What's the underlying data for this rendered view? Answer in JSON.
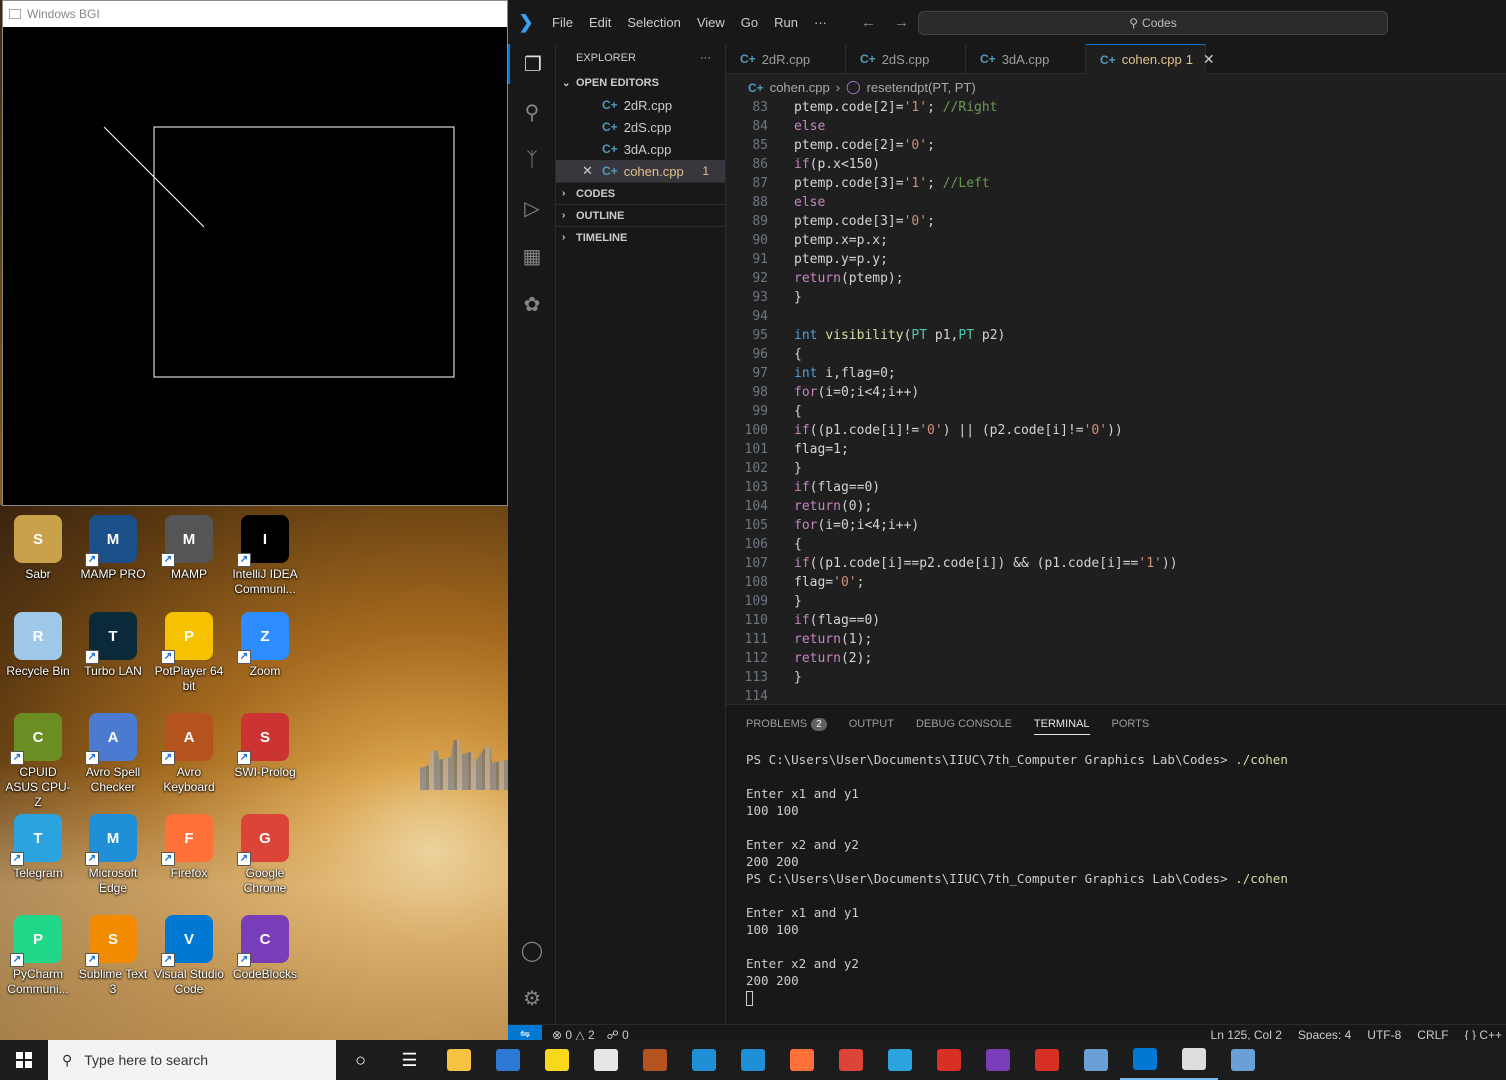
{
  "bgi_window": {
    "title": "Windows BGI"
  },
  "desktop_icons": [
    {
      "label": "Sabr",
      "color": "#c9a14a"
    },
    {
      "label": "MAMP PRO",
      "color": "#1b4f8a"
    },
    {
      "label": "MAMP",
      "color": "#555555"
    },
    {
      "label": "IntelliJ IDEA Communi...",
      "color": "#000000"
    },
    {
      "label": "Recycle Bin",
      "color": "#9ec7e8"
    },
    {
      "label": "Turbo LAN",
      "color": "#0a2a3a"
    },
    {
      "label": "PotPlayer 64 bit",
      "color": "#f6c200"
    },
    {
      "label": "Zoom",
      "color": "#2d8cff"
    },
    {
      "label": "CPUID ASUS CPU-Z",
      "color": "#6b8e23"
    },
    {
      "label": "Avro Spell Checker",
      "color": "#4a7bd0"
    },
    {
      "label": "Avro Keyboard",
      "color": "#b5531f"
    },
    {
      "label": "SWI-Prolog",
      "color": "#cc3333"
    },
    {
      "label": "Telegram",
      "color": "#2aa3df"
    },
    {
      "label": "Microsoft Edge",
      "color": "#1f8fd8"
    },
    {
      "label": "Firefox",
      "color": "#ff7139"
    },
    {
      "label": "Google Chrome",
      "color": "#db4437"
    },
    {
      "label": "PyCharm Communi...",
      "color": "#21d789"
    },
    {
      "label": "Sublime Text 3",
      "color": "#f28b00"
    },
    {
      "label": "Visual Studio Code",
      "color": "#0078d4"
    },
    {
      "label": "CodeBlocks",
      "color": "#7a3db8"
    }
  ],
  "vscode": {
    "menu": [
      "File",
      "Edit",
      "Selection",
      "View",
      "Go",
      "Run",
      "···"
    ],
    "command_center": "Codes",
    "explorer_title": "EXPLORER",
    "open_editors_label": "OPEN EDITORS",
    "open_editors": [
      {
        "name": "2dR.cpp"
      },
      {
        "name": "2dS.cpp"
      },
      {
        "name": "3dA.cpp"
      },
      {
        "name": "cohen.cpp",
        "problems": "1"
      }
    ],
    "sections": [
      "CODES",
      "OUTLINE",
      "TIMELINE"
    ],
    "tabs": [
      {
        "name": "2dR.cpp"
      },
      {
        "name": "2dS.cpp"
      },
      {
        "name": "3dA.cpp"
      },
      {
        "name": "cohen.cpp",
        "problems": "1"
      }
    ],
    "breadcrumb": {
      "file": "cohen.cpp",
      "symbol": "resetendpt(PT, PT)"
    },
    "code_lines": [
      {
        "n": "83",
        "text": "ptemp.code[2]='1'; //Right"
      },
      {
        "n": "84",
        "text": "else"
      },
      {
        "n": "85",
        "text": "ptemp.code[2]='0';"
      },
      {
        "n": "86",
        "text": "if(p.x<150)"
      },
      {
        "n": "87",
        "text": "ptemp.code[3]='1'; //Left"
      },
      {
        "n": "88",
        "text": "else"
      },
      {
        "n": "89",
        "text": "ptemp.code[3]='0';"
      },
      {
        "n": "90",
        "text": "ptemp.x=p.x;"
      },
      {
        "n": "91",
        "text": "ptemp.y=p.y;"
      },
      {
        "n": "92",
        "text": "return(ptemp);"
      },
      {
        "n": "93",
        "text": "}"
      },
      {
        "n": "94",
        "text": ""
      },
      {
        "n": "95",
        "text": "int visibility(PT p1,PT p2)"
      },
      {
        "n": "96",
        "text": "{"
      },
      {
        "n": "97",
        "text": "int i,flag=0;"
      },
      {
        "n": "98",
        "text": "for(i=0;i<4;i++)"
      },
      {
        "n": "99",
        "text": "{"
      },
      {
        "n": "100",
        "text": "if((p1.code[i]!='0') || (p2.code[i]!='0'))"
      },
      {
        "n": "101",
        "text": "flag=1;"
      },
      {
        "n": "102",
        "text": "}"
      },
      {
        "n": "103",
        "text": "if(flag==0)"
      },
      {
        "n": "104",
        "text": "return(0);"
      },
      {
        "n": "105",
        "text": "for(i=0;i<4;i++)"
      },
      {
        "n": "106",
        "text": "{"
      },
      {
        "n": "107",
        "text": "if((p1.code[i]==p2.code[i]) && (p1.code[i]=='1'))"
      },
      {
        "n": "108",
        "text": "flag='0';"
      },
      {
        "n": "109",
        "text": "}"
      },
      {
        "n": "110",
        "text": "if(flag==0)"
      },
      {
        "n": "111",
        "text": "return(1);"
      },
      {
        "n": "112",
        "text": "return(2);"
      },
      {
        "n": "113",
        "text": "}"
      },
      {
        "n": "114",
        "text": ""
      }
    ],
    "panel_tabs": [
      "PROBLEMS",
      "OUTPUT",
      "DEBUG CONSOLE",
      "TERMINAL",
      "PORTS"
    ],
    "problems_count": "2",
    "terminal_prompt": "PS C:\\Users\\User\\Documents\\IIUC\\7th_Computer Graphics Lab\\Codes>",
    "terminal_command": "./cohen",
    "terminal_runs": [
      {
        "p1_prompt": "Enter x1 and y1",
        "p1_value": "100 100",
        "p2_prompt": "Enter x2 and y2",
        "p2_value": "200 200"
      },
      {
        "p1_prompt": "Enter x1 and y1",
        "p1_value": "100 100",
        "p2_prompt": "Enter x2 and y2",
        "p2_value": "200 200"
      }
    ],
    "status": {
      "errors": "0",
      "warnings": "2",
      "ports": "0",
      "position": "Ln 125, Col 2",
      "spaces": "Spaces: 4",
      "encoding": "UTF-8",
      "eol": "CRLF",
      "language": "C++"
    }
  },
  "taskbar": {
    "search_placeholder": "Type here to search",
    "apps": [
      {
        "name": "task-view",
        "color": "#ffffff"
      },
      {
        "name": "file-explorer",
        "color": "#f6c343"
      },
      {
        "name": "microsoft-store",
        "color": "#2b79d4"
      },
      {
        "name": "sticky-notes",
        "color": "#f9d71c"
      },
      {
        "name": "mail",
        "color": "#e6e6e6"
      },
      {
        "name": "avro-keyboard",
        "color": "#b5531f"
      },
      {
        "name": "meet",
        "color": "#1f8fd8"
      },
      {
        "name": "edge",
        "color": "#1f8fd8"
      },
      {
        "name": "firefox",
        "color": "#ff7139"
      },
      {
        "name": "chrome",
        "color": "#db4437"
      },
      {
        "name": "telegram",
        "color": "#2aa3df"
      },
      {
        "name": "pdf-reader",
        "color": "#d93025"
      },
      {
        "name": "codeblocks",
        "color": "#7a3db8"
      },
      {
        "name": "pdf-editor",
        "color": "#d93025"
      },
      {
        "name": "control-panel",
        "color": "#6aa0d8"
      },
      {
        "name": "vscode",
        "color": "#0078d4"
      },
      {
        "name": "bgi-graphics",
        "color": "#dddddd"
      },
      {
        "name": "notepad",
        "color": "#6aa0d8"
      }
    ]
  }
}
